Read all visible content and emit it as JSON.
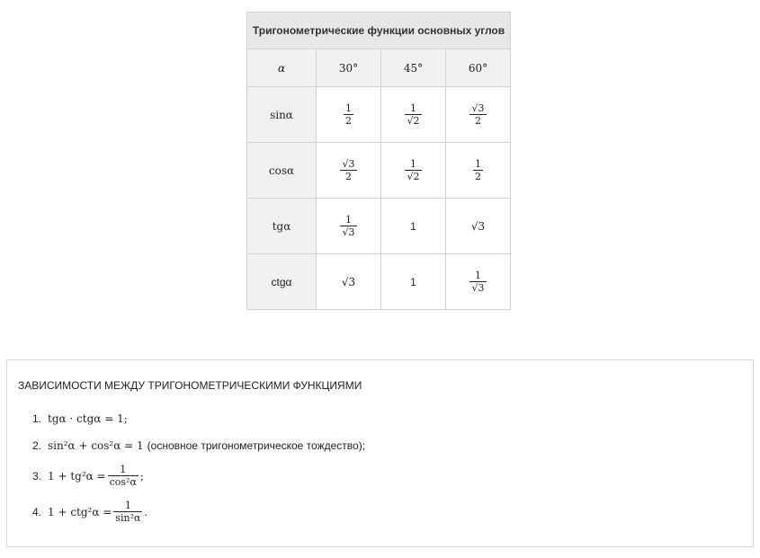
{
  "table": {
    "title": "Тригонометрические функции основных углов",
    "header": {
      "alpha": "α",
      "angles": [
        "30°",
        "45°",
        "60°"
      ]
    },
    "rows": [
      {
        "label": "sinα",
        "cells": [
          {
            "num": "1",
            "den": "2"
          },
          {
            "num": "1",
            "den": "√2"
          },
          {
            "num": "√3",
            "den": "2"
          }
        ]
      },
      {
        "label": "cosα",
        "cells": [
          {
            "num": "√3",
            "den": "2"
          },
          {
            "num": "1",
            "den": "√2"
          },
          {
            "num": "1",
            "den": "2"
          }
        ]
      },
      {
        "label": "tgα",
        "cells": [
          {
            "num": "1",
            "den": "√3"
          },
          {
            "value": "1"
          },
          {
            "value": "√3"
          }
        ]
      },
      {
        "label": "ctgα",
        "cells": [
          {
            "value": "√3"
          },
          {
            "value": "1"
          },
          {
            "num": "1",
            "den": "√3"
          }
        ]
      }
    ]
  },
  "relations": {
    "title": "ЗАВИСИМОСТИ МЕЖДУ ТРИГОНОМЕТРИЧЕСКИМИ ФУНКЦИЯМИ",
    "items": [
      {
        "n": "1.",
        "text": "tgα · ctgα = 1;"
      },
      {
        "n": "2.",
        "text": "sin²α + cos²α = 1",
        "note": "(основное тригонометрическое тождество);"
      },
      {
        "n": "3.",
        "lhs": "1 + tg²α =",
        "num": "1",
        "den": "cos²α",
        "end": ";"
      },
      {
        "n": "4.",
        "lhs": "1 + ctg²α =",
        "num": "1",
        "den": "sin²α",
        "end": "."
      }
    ]
  }
}
